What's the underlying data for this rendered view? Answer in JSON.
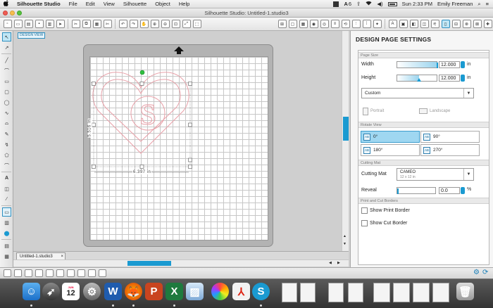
{
  "menubar": {
    "apple": "",
    "items": [
      "Silhouette Studio",
      "File",
      "Edit",
      "View",
      "Silhouette",
      "Object",
      "Help"
    ],
    "status": {
      "battery_badge": "6",
      "time": "Sun 2:33 PM",
      "user": "Emily Freeman"
    }
  },
  "window": {
    "title": "Silhouette Studio: Untitled-1.studio3"
  },
  "canvas": {
    "design_view_label": "DESIGN VIEW",
    "width_dim": "6.397 in",
    "height_dim": "5.516 in",
    "tab_label": "Untitled-1.studio3"
  },
  "panel": {
    "title": "DESIGN PAGE SETTINGS",
    "page_size": {
      "section": "Page Size",
      "width_label": "Width",
      "width_value": "12.000",
      "width_unit": "in",
      "height_label": "Height",
      "height_value": "12.000",
      "height_unit": "in",
      "preset": "Custom",
      "portrait": "Portrait",
      "landscape": "Landscape"
    },
    "rotate_view": {
      "section": "Rotate View",
      "options": [
        "0°",
        "90°",
        "180°",
        "270°"
      ],
      "selected": "0°"
    },
    "cutting_mat": {
      "section": "Cutting Mat",
      "label": "Cutting Mat",
      "value": "CAMEO",
      "value_sub": "12 x 12 in",
      "reveal_label": "Reveal",
      "reveal_value": "0.0",
      "reveal_unit": "%"
    },
    "borders": {
      "section": "Print and Cut Borders",
      "show_print_border": "Show Print Border",
      "show_cut_border": "Show Cut Border"
    }
  },
  "colors": {
    "accent": "#1a9ad1",
    "selection": "#9fd7f1",
    "heart_stroke": "#e8a0a8"
  },
  "dock": {
    "calendar_day": "12",
    "calendar_month": "JUN"
  }
}
